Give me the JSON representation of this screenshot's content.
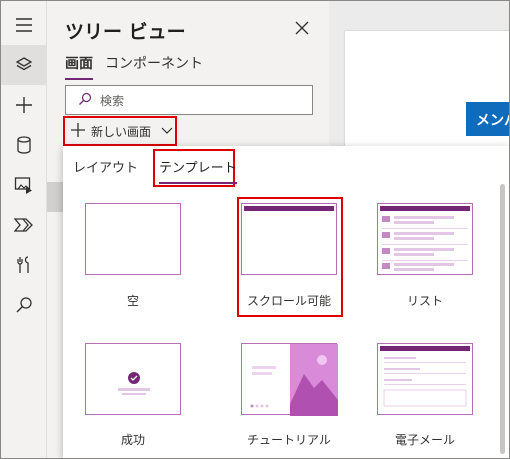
{
  "tree_view": {
    "title": "ツリー ビュー",
    "tabs": [
      {
        "label": "画面",
        "active": true
      },
      {
        "label": "コンポーネント",
        "active": false
      }
    ],
    "search": {
      "placeholder": "検索",
      "value": ""
    },
    "new_screen_label": "新しい画面"
  },
  "canvas": {
    "header_text": "メンバ"
  },
  "popup": {
    "tabs": [
      {
        "label": "レイアウト",
        "active": false
      },
      {
        "label": "テンプレート",
        "active": true
      }
    ],
    "templates": [
      {
        "label": "空",
        "icon": "blank-template-thumbnail"
      },
      {
        "label": "スクロール可能",
        "icon": "scrollable-template-thumbnail",
        "highlighted": true
      },
      {
        "label": "リスト",
        "icon": "list-template-thumbnail"
      },
      {
        "label": "成功",
        "icon": "success-template-thumbnail"
      },
      {
        "label": "チュートリアル",
        "icon": "tutorial-template-thumbnail"
      },
      {
        "label": "電子メール",
        "icon": "email-template-thumbnail"
      }
    ]
  },
  "rail": {
    "icons": [
      "hamburger-icon",
      "layers-icon",
      "plus-icon",
      "database-icon",
      "media-icon",
      "power-automate-icon",
      "tools-icon",
      "search-icon"
    ]
  },
  "colors": {
    "accent": "#742774",
    "highlight": "#e00000",
    "canvas_header": "#0f6cbd"
  }
}
